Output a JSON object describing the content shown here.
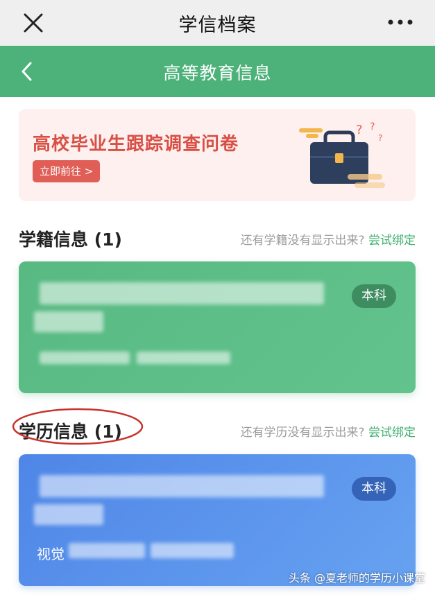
{
  "titlebar": {
    "title": "学信档案"
  },
  "navbar": {
    "title": "高等教育信息"
  },
  "banner": {
    "headline": "高校毕业生跟踪调查问卷",
    "button_label": "立即前往 >"
  },
  "sections": {
    "enrollment": {
      "label": "学籍信息 (1)",
      "hint": "还有学籍没有显示出来?",
      "link": "尝试绑定",
      "badge": "本科"
    },
    "degree": {
      "label": "学历信息 (1)",
      "hint": "还有学历没有显示出来?",
      "link": "尝试绑定",
      "badge": "本科",
      "prefix": "视觉"
    }
  },
  "watermark": "头条 @夏老师的学历小课堂",
  "colors": {
    "nav_green": "#4cb27a",
    "card_green": "#5cbc86",
    "card_blue": "#5890ea",
    "banner_red": "#d94f45",
    "link_green": "#3fae72",
    "oval_red": "#c9332c"
  }
}
